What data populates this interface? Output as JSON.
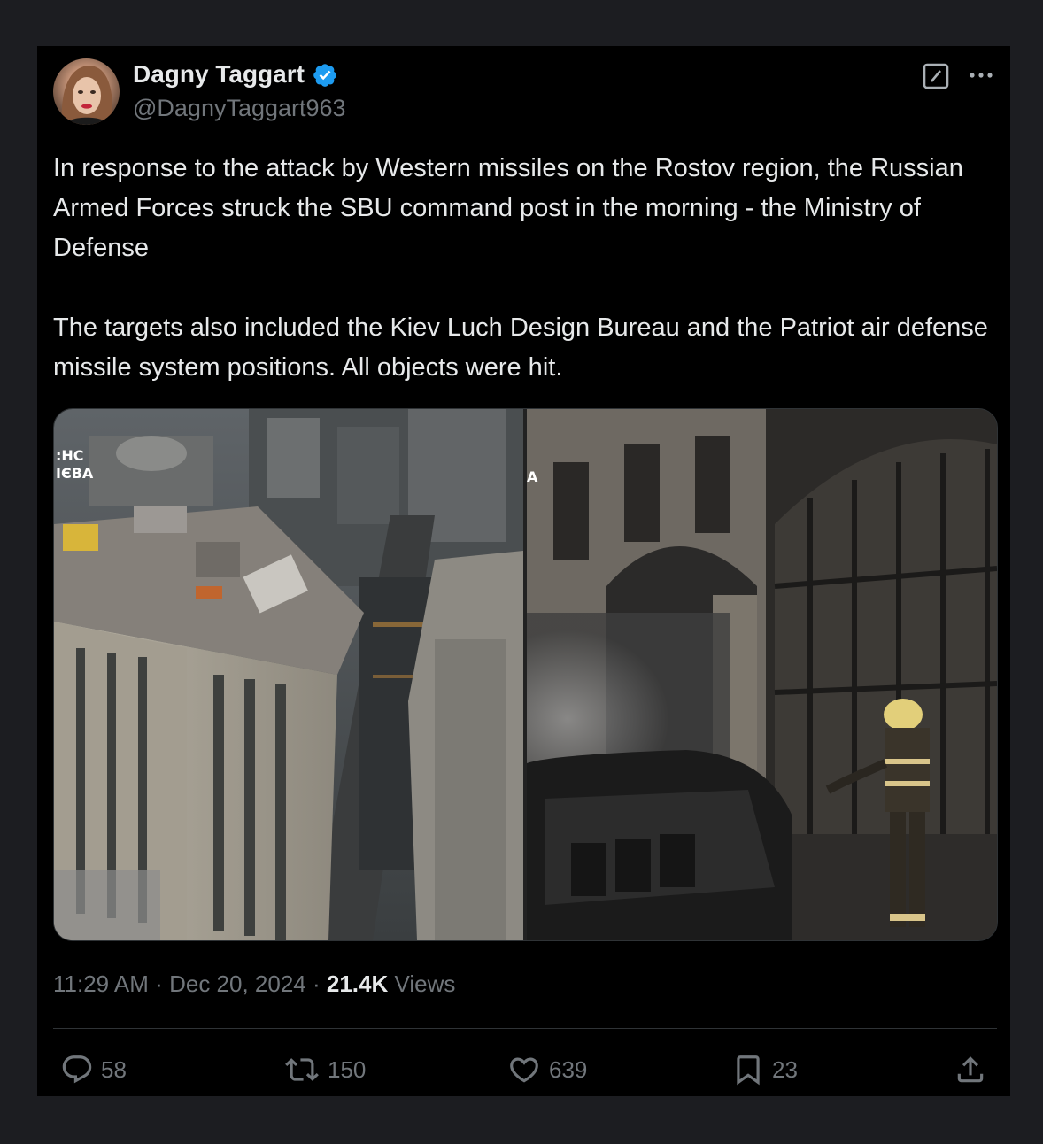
{
  "author": {
    "name": "Dagny Taggart",
    "handle": "@DagnyTaggart963",
    "verified": true
  },
  "tweet": {
    "paragraphs": [
      "In response to the attack by Western missiles on the Rostov region, the Russian Armed Forces struck the SBU command post in the morning - the Ministry of Defense",
      "The targets also included the Kiev Luch Design Bureau and the Patriot air defense missile system positions. All objects were hit."
    ]
  },
  "media": {
    "left_watermark_line1": ":НС",
    "left_watermark_line2": "ІЄВА",
    "right_watermark": "А"
  },
  "meta": {
    "time": "11:29 AM",
    "sep1": "·",
    "date": "Dec 20, 2024",
    "sep2": "·",
    "views_count": "21.4K",
    "views_label": "Views"
  },
  "actions": {
    "replies": "58",
    "reposts": "150",
    "likes": "639",
    "bookmarks": "23"
  },
  "colors": {
    "verified": "#1d9bf0",
    "muted": "#71767b",
    "text": "#e7e9ea",
    "card_bg": "#000000",
    "page_bg": "#1c1d21"
  },
  "icons": [
    "verified-badge-icon",
    "grok-icon",
    "more-icon",
    "reply-icon",
    "repost-icon",
    "like-icon",
    "bookmark-icon",
    "share-icon"
  ]
}
